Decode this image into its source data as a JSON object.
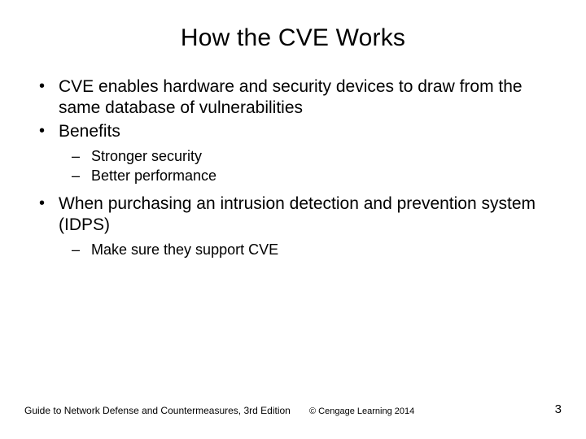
{
  "title": "How the CVE Works",
  "bullets": [
    {
      "text": "CVE enables hardware and security devices to draw from the same database of vulnerabilities"
    },
    {
      "text": "Benefits",
      "sub": [
        "Stronger security",
        "Better performance"
      ]
    },
    {
      "text": "When purchasing an intrusion detection and prevention system (IDPS)",
      "sub": [
        "Make sure they support CVE"
      ]
    }
  ],
  "footer": {
    "left": "Guide to Network Defense and Countermeasures, 3rd Edition",
    "center": "© Cengage Learning  2014",
    "page": "3"
  }
}
